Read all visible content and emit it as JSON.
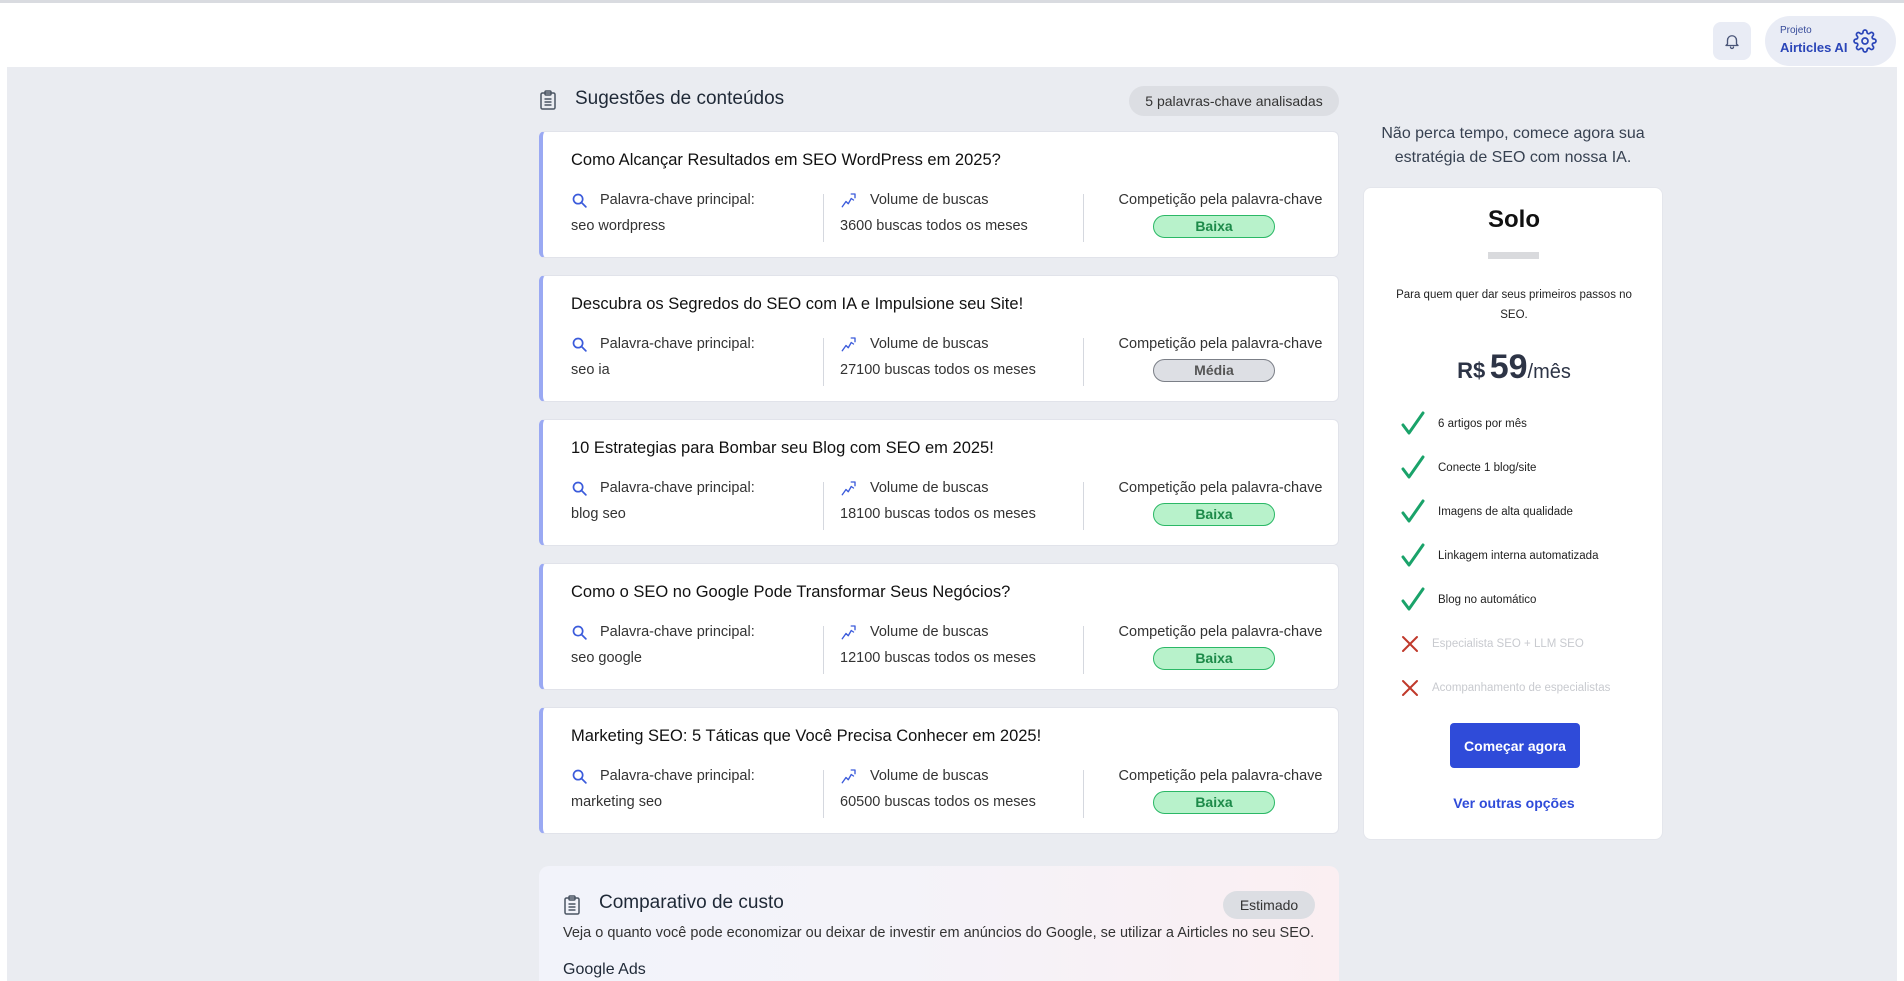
{
  "header": {
    "project_label": "Projeto",
    "project_name": "Airticles AI"
  },
  "suggestions": {
    "title": "Sugestões de conteúdos",
    "analyzed_badge": "5 palavras-chave analisadas",
    "keyword_label": "Palavra-chave principal:",
    "volume_label": "Volume de buscas",
    "competition_label": "Competição pela palavra-chave",
    "cards": [
      {
        "title": "Como Alcançar Resultados em SEO WordPress em 2025?",
        "keyword": "seo wordpress",
        "volume": "3600 buscas todos os meses",
        "competition": "Baixa"
      },
      {
        "title": "Descubra os Segredos do SEO com IA e Impulsione seu Site!",
        "keyword": "seo ia",
        "volume": "27100 buscas todos os meses",
        "competition": "Média"
      },
      {
        "title": "10 Estrategias para Bombar seu Blog com SEO em 2025!",
        "keyword": "blog seo",
        "volume": "18100 buscas todos os meses",
        "competition": "Baixa"
      },
      {
        "title": "Como o SEO no Google Pode Transformar Seus Negócios?",
        "keyword": "seo google",
        "volume": "12100 buscas todos os meses",
        "competition": "Baixa"
      },
      {
        "title": "Marketing SEO: 5 Táticas que Você Precisa Conhecer em 2025!",
        "keyword": "marketing seo",
        "volume": "60500 buscas todos os meses",
        "competition": "Baixa"
      }
    ]
  },
  "cost": {
    "title": "Comparativo de custo",
    "badge": "Estimado",
    "description": "Veja o quanto você pode economizar ou deixar de investir em anúncios do Google, se utilizar a Airticles no seu SEO.",
    "subtitle": "Google Ads"
  },
  "pricing": {
    "promo": "Não perca tempo, comece agora sua estratégia de SEO com nossa IA.",
    "plan_name": "Solo",
    "plan_desc": "Para quem quer dar seus primeiros passos no SEO.",
    "currency": "R$",
    "amount": "59",
    "period": "/mês",
    "features": [
      {
        "text": "6 artigos por mês",
        "included": true
      },
      {
        "text": "Conecte 1 blog/site",
        "included": true
      },
      {
        "text": "Imagens de alta qualidade",
        "included": true
      },
      {
        "text": "Linkagem interna automatizada",
        "included": true
      },
      {
        "text": "Blog no automático",
        "included": true
      },
      {
        "text": "Especialista SEO + LLM SEO",
        "included": false
      },
      {
        "text": "Acompanhamento de especialistas",
        "included": false
      }
    ],
    "cta": "Começar agora",
    "other_options": "Ver outras opções"
  },
  "colors": {
    "accent": "#2f4bd9",
    "low_badge_bg": "#b8f2cb",
    "medium_badge_bg": "#dddfe4",
    "check": "#1aa36a",
    "cross": "#c0392b"
  }
}
